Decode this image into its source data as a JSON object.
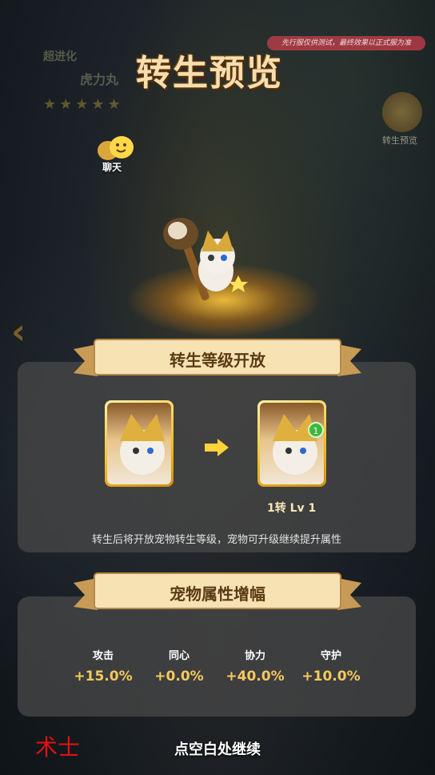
{
  "top": {
    "notice": "先行服仅供测试，最终效果以正式服为准",
    "title": "转生预览",
    "ghost_tag": "超进化",
    "ghost_pet_name": "虎力丸",
    "stars": "★★★★★",
    "chat_label": "聊天",
    "rebirth_preview_label": "转生预览"
  },
  "section1": {
    "banner": "转生等级开放",
    "result_label": "1转 Lv 1",
    "badge_number": "1",
    "description": "转生后将开放宠物转生等级，宠物可升级继续提升属性"
  },
  "section2": {
    "banner": "宠物属性增幅",
    "attributes": [
      {
        "name": "攻击",
        "value": "+15.0%"
      },
      {
        "name": "同心",
        "value": "+0.0%"
      },
      {
        "name": "协力",
        "value": "+40.0%"
      },
      {
        "name": "守护",
        "value": "+10.0%"
      }
    ]
  },
  "bottom": {
    "class_label": "术士",
    "continue": "点空白处继续"
  },
  "colors": {
    "accent_gold": "#f5c95e",
    "banner_text": "#5a3a14",
    "class_red": "#e21010"
  }
}
